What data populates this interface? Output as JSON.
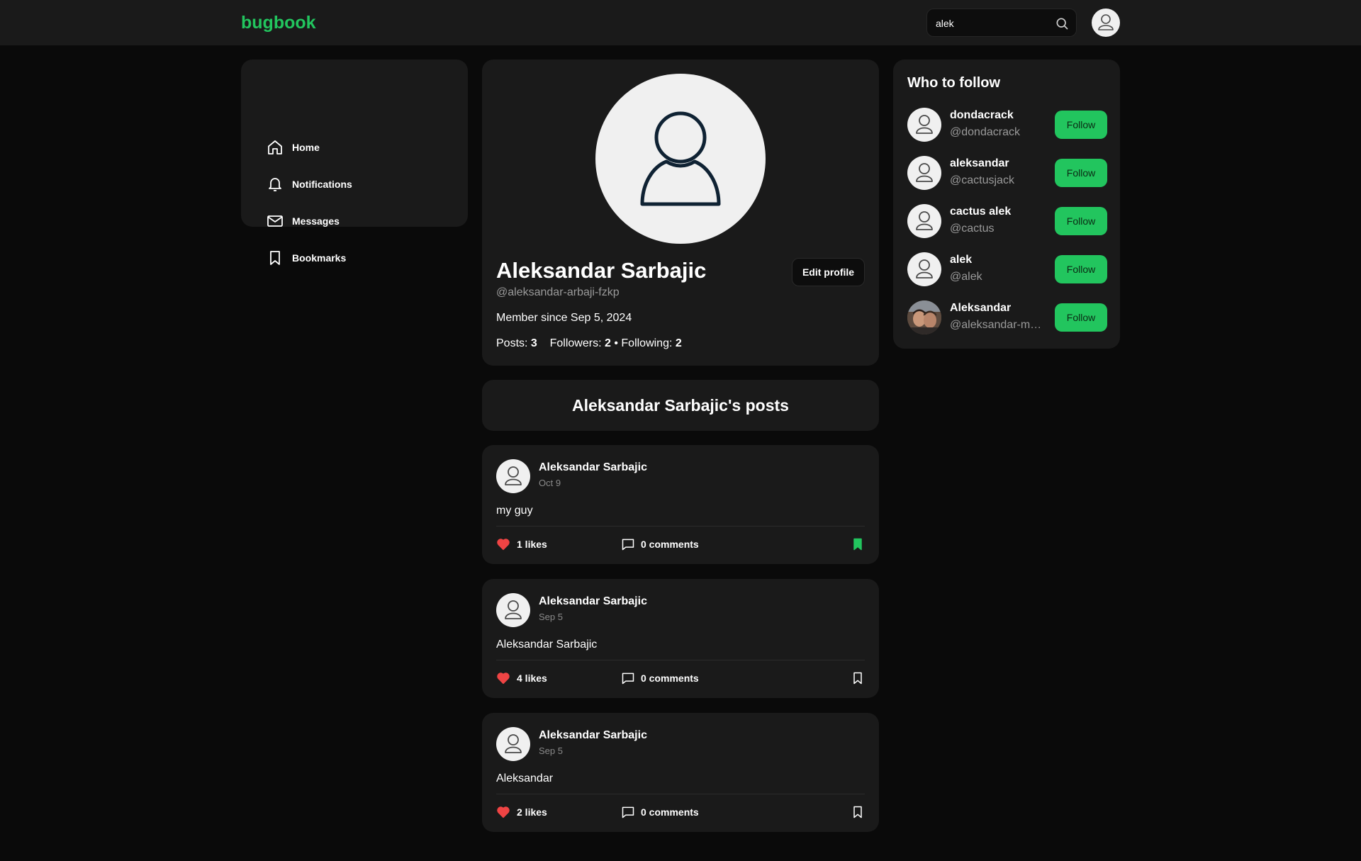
{
  "header": {
    "logo": "bugbook",
    "search_value": "alek",
    "search_placeholder": "Search"
  },
  "nav": {
    "items": [
      {
        "label": "Home",
        "icon": "home-icon"
      },
      {
        "label": "Notifications",
        "icon": "bell-icon"
      },
      {
        "label": "Messages",
        "icon": "mail-icon"
      },
      {
        "label": "Bookmarks",
        "icon": "bookmark-icon"
      }
    ]
  },
  "profile": {
    "name": "Aleksandar Sarbajic",
    "handle": "@aleksandar-arbaji-fzkp",
    "member_since": "Member since Sep 5, 2024",
    "posts_label": "Posts:",
    "posts_count": "3",
    "followers_label": "Followers:",
    "followers_count": "2",
    "separator": "•",
    "following_label": "Following:",
    "following_count": "2",
    "edit_label": "Edit profile"
  },
  "posts_title": "Aleksandar Sarbajic's posts",
  "posts": [
    {
      "author": "Aleksandar Sarbajic",
      "date": "Oct 9",
      "content": "my guy",
      "likes": "1 likes",
      "comments": "0 comments",
      "bookmarked": true
    },
    {
      "author": "Aleksandar Sarbajic",
      "date": "Sep 5",
      "content": "Aleksandar Sarbajic",
      "likes": "4 likes",
      "comments": "0 comments",
      "bookmarked": false
    },
    {
      "author": "Aleksandar Sarbajic",
      "date": "Sep 5",
      "content": "Aleksandar",
      "likes": "2 likes",
      "comments": "0 comments",
      "bookmarked": false
    }
  ],
  "who_to_follow": {
    "title": "Who to follow",
    "users": [
      {
        "name": "dondacrack",
        "handle": "@dondacrack",
        "button": "Follow"
      },
      {
        "name": "aleksandar",
        "handle": "@cactusjack",
        "button": "Follow"
      },
      {
        "name": "cactus alek",
        "handle": "@cactus",
        "button": "Follow"
      },
      {
        "name": "alek",
        "handle": "@alek",
        "button": "Follow"
      },
      {
        "name": "Aleksandar",
        "handle": "@aleksandar-mx...",
        "button": "Follow"
      }
    ]
  },
  "colors": {
    "accent": "#22c55e",
    "background": "#0a0a0a",
    "card": "#1a1a1a",
    "like": "#ef4444"
  }
}
